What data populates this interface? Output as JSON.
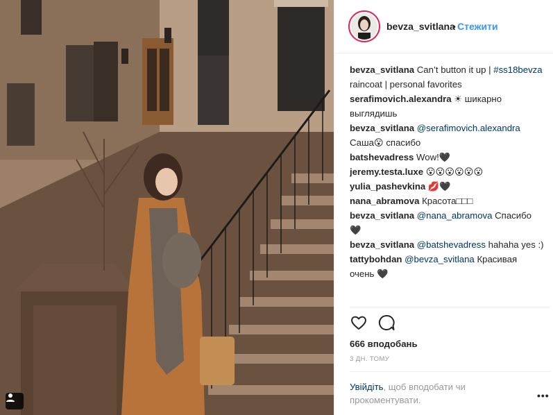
{
  "header": {
    "username": "bevza_svitlana",
    "separator": "•",
    "follow_label": "Стежити"
  },
  "comments": [
    {
      "user": "bevza_svitlana",
      "parts": [
        {
          "text": " Can’t button it up | "
        },
        {
          "tag": "#ss18bevza"
        },
        {
          "text": " raincoat | personal favorites"
        }
      ]
    },
    {
      "user": "serafimovich.alexandra",
      "parts": [
        {
          "text": " ☀ шикарно выглядишь"
        }
      ]
    },
    {
      "user": "bevza_svitlana",
      "parts": [
        {
          "text": " "
        },
        {
          "tag": "@serafimovich.alexandra"
        },
        {
          "text": " Саша😮 спасибо"
        }
      ]
    },
    {
      "user": "batshevadress",
      "parts": [
        {
          "text": " Wow!🖤"
        }
      ]
    },
    {
      "user": "jeremy.testa.luxe",
      "parts": [
        {
          "text": " 😮😮😮😮😮😮"
        }
      ]
    },
    {
      "user": "yulia_pashevkina",
      "parts": [
        {
          "text": " 💋🖤"
        }
      ]
    },
    {
      "user": "nana_abramova",
      "parts": [
        {
          "text": " Красота□□□"
        }
      ]
    },
    {
      "user": "bevza_svitlana",
      "parts": [
        {
          "text": " "
        },
        {
          "tag": "@nana_abramova"
        },
        {
          "text": " Спасибо 🖤"
        }
      ]
    },
    {
      "user": "bevza_svitlana",
      "parts": [
        {
          "text": " "
        },
        {
          "tag": "@batshevadress"
        },
        {
          "text": " hahaha yes :)"
        }
      ]
    },
    {
      "user": "tattybohdan",
      "parts": [
        {
          "text": " "
        },
        {
          "tag": "@bevza_svitlana"
        },
        {
          "text": " Красивая очень 🖤"
        }
      ]
    }
  ],
  "likes_text": "666 вподобань",
  "time_text": "3 дн. тому",
  "login": {
    "link": "Увійдіть",
    "rest": ", щоб вподобати чи прокоментувати."
  },
  "more_label": "•••",
  "icons": {
    "like": "heart-icon",
    "comment": "comment-bubble-icon",
    "tag": "person-tag-icon"
  },
  "colors": {
    "follow": "#3897f0",
    "mention": "#003569",
    "avatar_ring": "#e0245e"
  }
}
